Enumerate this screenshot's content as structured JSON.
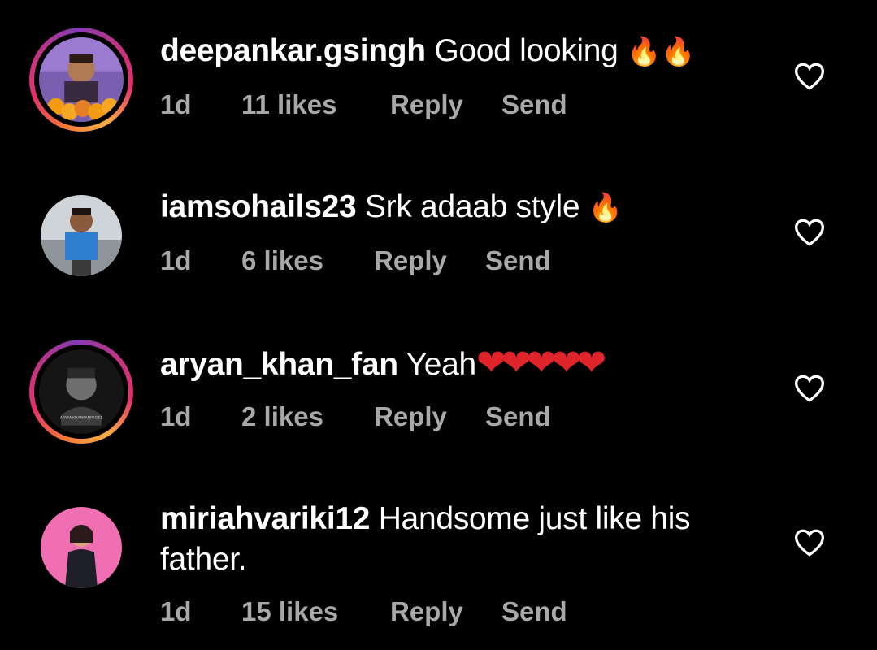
{
  "comments": [
    {
      "username": "deepankar.gsingh",
      "text": "Good looking",
      "emojis": "🔥🔥",
      "time": "1d",
      "likes": "11 likes",
      "reply": "Reply",
      "send": "Send",
      "story_ring": true
    },
    {
      "username": "iamsohails23",
      "text": "Srk adaab style",
      "emojis": "🔥",
      "time": "1d",
      "likes": "6 likes",
      "reply": "Reply",
      "send": "Send",
      "story_ring": false
    },
    {
      "username": "aryan_khan_fan",
      "text": "Yeah",
      "emojis": "❤❤❤❤❤",
      "time": "1d",
      "likes": "2 likes",
      "reply": "Reply",
      "send": "Send",
      "story_ring": true,
      "avatar_caption": "ARYANKHANFANPAGE1"
    },
    {
      "username": "miriahvariki12",
      "text": "Handsome just like his father.",
      "emojis": "",
      "time": "1d",
      "likes": "15 likes",
      "reply": "Reply",
      "send": "Send",
      "story_ring": false
    }
  ],
  "colors": {
    "background": "#000000",
    "meta": "#a8a8a8",
    "ring_start": "#f77737",
    "ring_end": "#c13584"
  },
  "icons": {
    "like": "heart-outline-icon"
  }
}
